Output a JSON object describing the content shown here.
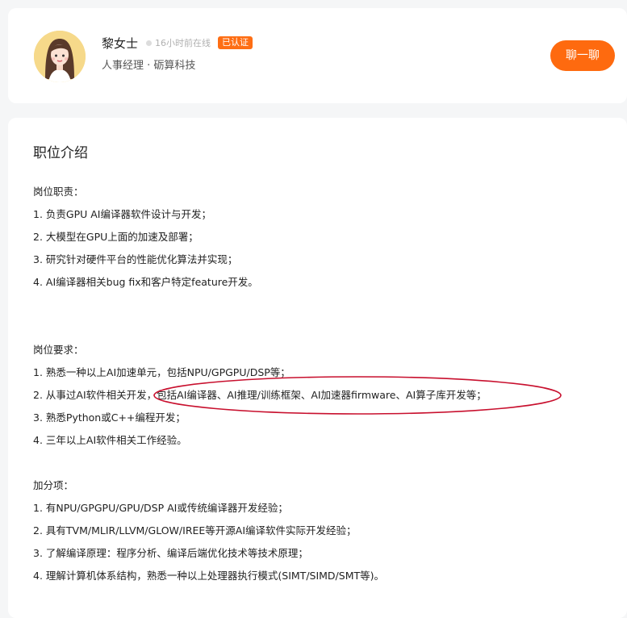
{
  "recruiter": {
    "name": "黎女士",
    "online_status": "16小时前在线",
    "verified_label": "已认证",
    "subtitle": "人事经理 · 砺算科技",
    "chat_button": "聊一聊"
  },
  "job": {
    "section_title": "职位介绍",
    "lines": [
      "岗位职责：",
      "1. 负责GPU AI编译器软件设计与开发；",
      "2. 大模型在GPU上面的加速及部署；",
      "3. 研究针对硬件平台的性能优化算法并实现；",
      "4. AI编译器相关bug fix和客户特定feature开发。",
      "",
      "",
      "岗位要求：",
      "1. 熟悉一种以上AI加速单元，包括NPU/GPGPU/DSP等；",
      "2. 从事过AI软件相关开发，包括AI编译器、AI推理/训练框架、AI加速器firmware、AI算子库开发等；",
      "3. 熟悉Python或C++编程开发；",
      "4. 三年以上AI软件相关工作经验。",
      "",
      "加分项：",
      "1. 有NPU/GPGPU/GPU/DSP AI或传统编译器开发经验；",
      "2. 具有TVM/MLIR/LLVM/GLOW/IREE等开源AI编译软件实际开发经验；",
      "3. 了解编译原理：程序分析、编译后端优化技术等技术原理；",
      "4. 理解计算机体系结构，熟悉一种以上处理器执行模式(SIMT/SIMD/SMT等)。"
    ]
  },
  "colors": {
    "accent": "#fe6a0f",
    "annotation": "#c8102e"
  }
}
